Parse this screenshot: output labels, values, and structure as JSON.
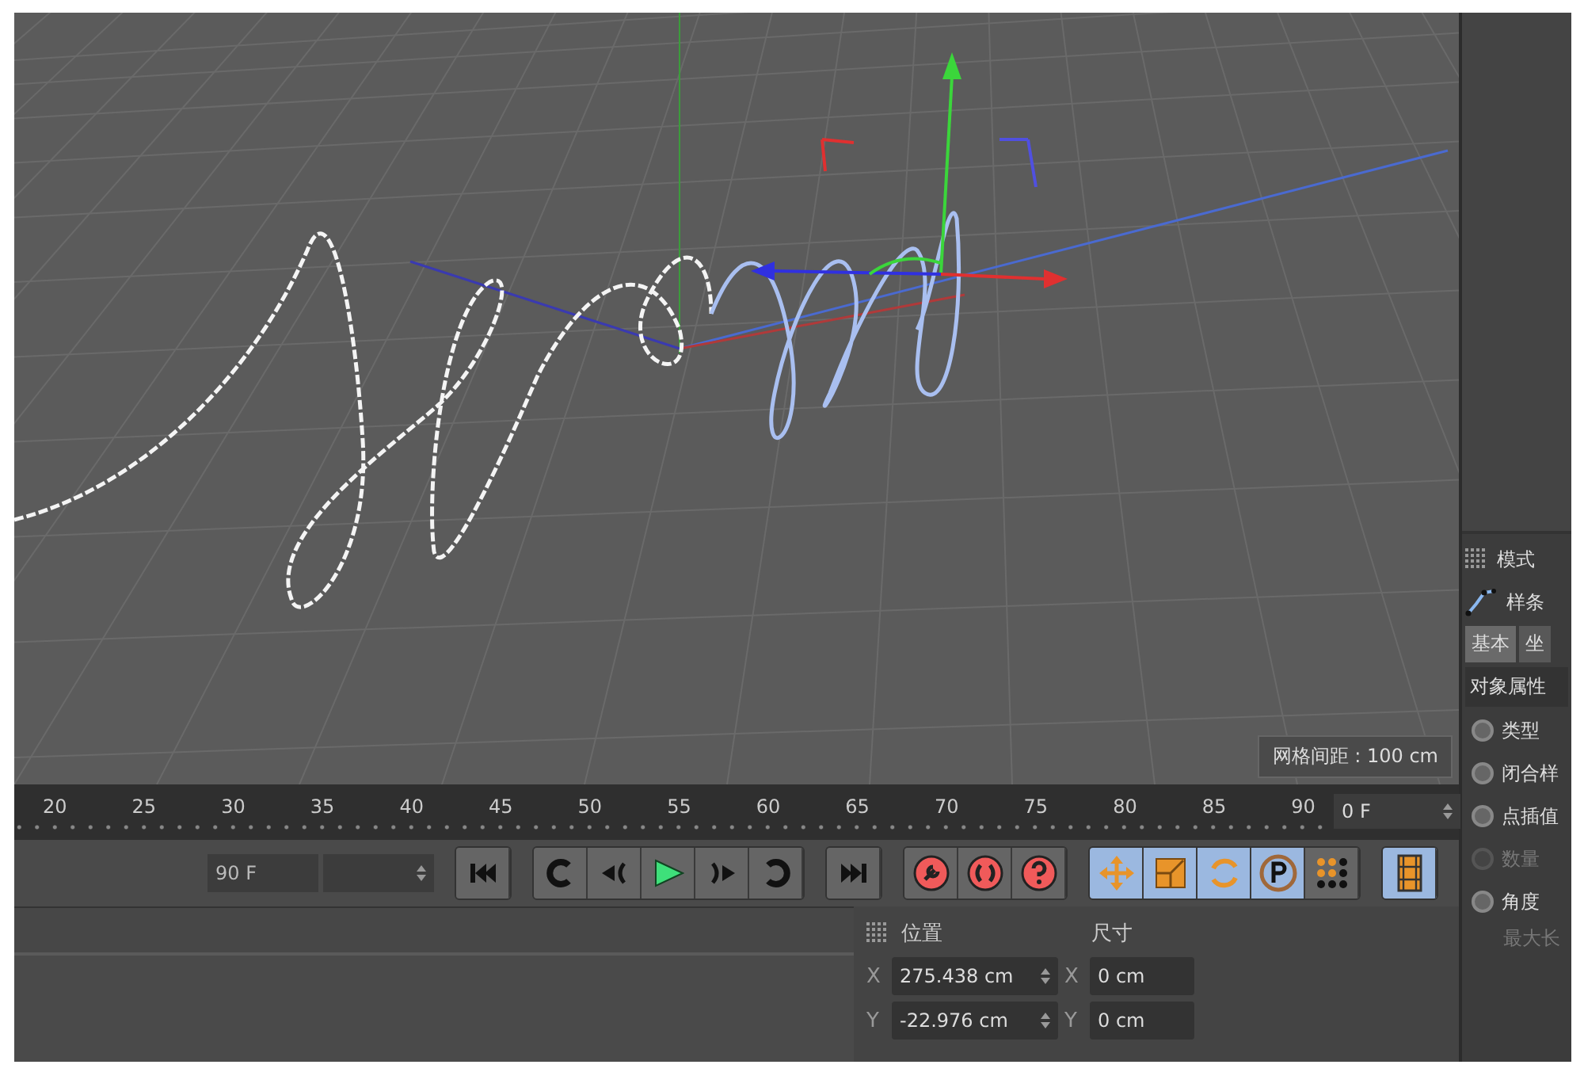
{
  "viewport": {
    "grid_label": "网格间距 : 100 cm"
  },
  "timeline": {
    "ticks": [
      "20",
      "25",
      "30",
      "35",
      "40",
      "45",
      "50",
      "55",
      "60",
      "65",
      "70",
      "75",
      "80",
      "85",
      "90"
    ],
    "current_frame": "0 F"
  },
  "transport": {
    "end_field": "90 F",
    "play_active": true,
    "key_tools": [
      {
        "on": false
      },
      {
        "on": false
      },
      {
        "on": false
      }
    ],
    "key_filters": [
      {
        "on": true
      },
      {
        "on": true
      },
      {
        "on": true
      },
      {
        "on": true
      },
      {
        "on": false
      }
    ],
    "timeline_toggle": {
      "on": true
    }
  },
  "coordinates": {
    "headers": [
      "位置",
      "尺寸"
    ],
    "rows": [
      {
        "axis": "X",
        "position": "275.438 cm",
        "size_axis": "X",
        "size": "0 cm"
      },
      {
        "axis": "Y",
        "position": "-22.976 cm",
        "size_axis": "Y",
        "size": "0 cm"
      }
    ]
  },
  "attributes": {
    "mode": "模式",
    "object": "样条",
    "tabs": [
      {
        "label": "基本",
        "selected": true
      },
      {
        "label": "坐",
        "selected": false
      }
    ],
    "section": "对象属性",
    "params": [
      {
        "label": "类型",
        "disabled": false
      },
      {
        "label": "闭合样",
        "disabled": false
      },
      {
        "label": "点插值",
        "disabled": false
      },
      {
        "label": "数量",
        "disabled": true
      },
      {
        "label": "角度",
        "disabled": false
      }
    ],
    "note": "最大长"
  }
}
